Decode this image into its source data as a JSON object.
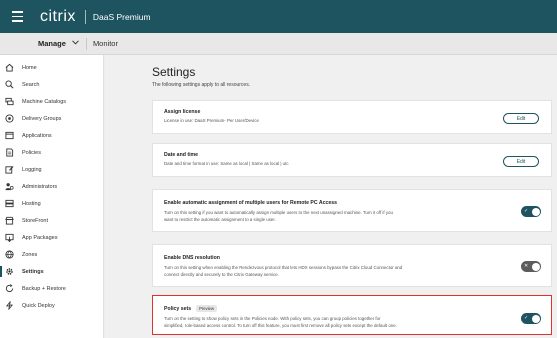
{
  "topbar": {
    "brand": "citrix",
    "product": "DaaS Premium",
    "background": "#1e5360"
  },
  "subbar": {
    "manage_label": "Manage",
    "monitor_label": "Monitor"
  },
  "sidebar": {
    "items": [
      {
        "label": "Home",
        "icon": "home-icon"
      },
      {
        "label": "Search",
        "icon": "search-icon"
      },
      {
        "label": "Machine Catalogs",
        "icon": "machine-catalogs-icon"
      },
      {
        "label": "Delivery Groups",
        "icon": "delivery-groups-icon"
      },
      {
        "label": "Applications",
        "icon": "applications-icon"
      },
      {
        "label": "Policies",
        "icon": "policies-icon"
      },
      {
        "label": "Logging",
        "icon": "logging-icon"
      },
      {
        "label": "Administrators",
        "icon": "administrators-icon"
      },
      {
        "label": "Hosting",
        "icon": "hosting-icon"
      },
      {
        "label": "StoreFront",
        "icon": "storefront-icon"
      },
      {
        "label": "App Packages",
        "icon": "app-packages-icon"
      },
      {
        "label": "Zones",
        "icon": "zones-icon"
      },
      {
        "label": "Settings",
        "icon": "settings-icon",
        "active": true
      },
      {
        "label": "Backup + Restore",
        "icon": "backup-restore-icon"
      },
      {
        "label": "Quick Deploy",
        "icon": "quick-deploy-icon"
      }
    ]
  },
  "main": {
    "title": "Settings",
    "subtitle": "The following settings apply to all resources.",
    "cards": [
      {
        "title": "Assign license",
        "desc": "License in use: DaaS Premium- Per User/Device",
        "control": "edit",
        "button_label": "Edit"
      },
      {
        "title": "Date and time",
        "desc": "Date and time format in use: Same as local | Same as local | utc",
        "control": "edit",
        "button_label": "Edit"
      },
      {
        "title": "Enable automatic assignment of multiple users for Remote PC Access",
        "desc_line1": "Turn on this setting if you want to automatically assign multiple users to the next unassigned machine. Turn it off if you",
        "desc_line2": "want to restrict the automatic assignment to a single user.",
        "control": "toggle",
        "toggle_state": "on"
      },
      {
        "title": "Enable DNS resolution",
        "desc_line1": "Turn on this setting when enabling the Rendezvous protocol that lets HDX sessions bypass the Citrix Cloud Connector and",
        "desc_line2": "connect directly and securely to the Citrix Gateway service.",
        "control": "toggle",
        "toggle_state": "off"
      },
      {
        "title": "Policy sets",
        "badge": "Preview",
        "desc_line1": "Turn on the setting to show policy sets in the Policies node. With policy sets, you can group policies together for",
        "desc_line2": "simplified, role-based access control. To turn off this feature, you must first remove all policy sets except the default one.",
        "control": "toggle",
        "toggle_state": "on",
        "highlight_color": "#e03131"
      }
    ]
  }
}
